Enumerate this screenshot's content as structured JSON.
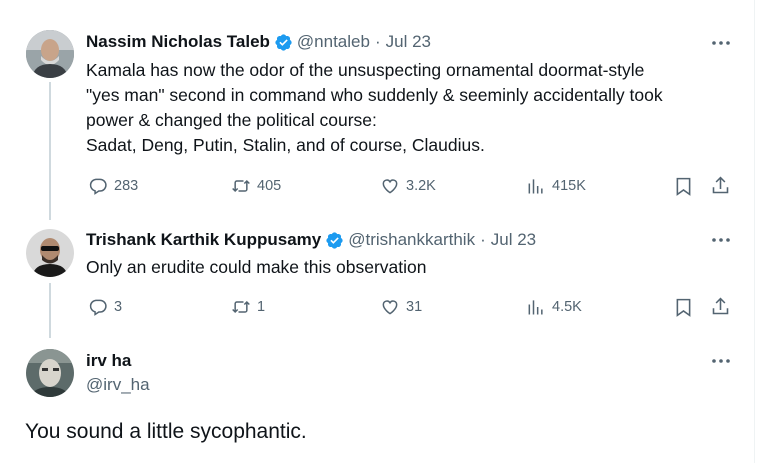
{
  "tweets": [
    {
      "name": "Nassim Nicholas Taleb",
      "handle": "@nntaleb",
      "date": "Jul 23",
      "text": [
        "Kamala has now the odor of the unsuspecting ornamental doormat-style",
        "\"yes man\" second in command who suddenly & seeminly accidentally took",
        "power & changed the political course:",
        "Sadat, Deng, Putin, Stalin, and of course, Claudius."
      ],
      "replies": "283",
      "reposts": "405",
      "likes": "3.2K",
      "views": "415K"
    },
    {
      "name": "Trishank Karthik Kuppusamy",
      "handle": "@trishankkarthik",
      "date": "Jul 23",
      "text": [
        "Only an erudite could make this observation"
      ],
      "replies": "3",
      "reposts": "1",
      "likes": "31",
      "views": "4.5K"
    }
  ],
  "reply": {
    "name": "irv ha",
    "handle": "@irv_ha",
    "text": "You sound a little sycophantic."
  },
  "colors": {
    "verified": "#1d9bf0",
    "muted": "#536471",
    "line": "#cfd9de"
  }
}
